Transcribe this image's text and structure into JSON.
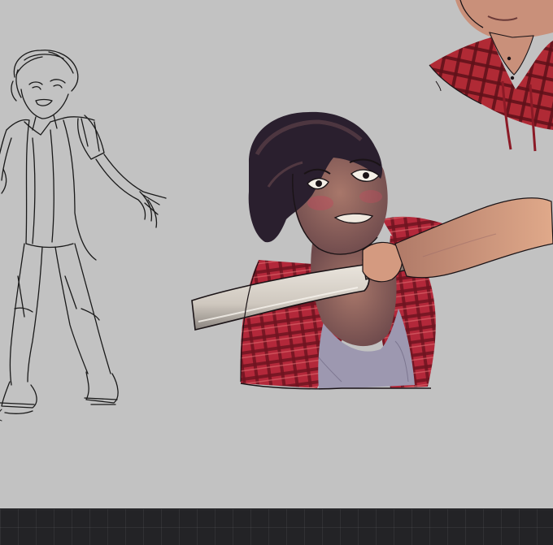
{
  "canvas": {
    "background_color": "#c2c2c2",
    "sketches": [
      {
        "name": "standing-figure-pencil-sketch",
        "style": "line-art",
        "color": "#1a1a1a"
      },
      {
        "name": "character-with-machete-colored-sketch",
        "style": "colored",
        "colors": {
          "hair": "#2a1f2e",
          "skin": "#9b6a5a",
          "shirt": "#b3283a",
          "tanktop": "#9d98b0",
          "blade": "#d8d3cc"
        }
      },
      {
        "name": "partial-torso-colored-sketch",
        "style": "colored",
        "colors": {
          "skin": "#c9907a",
          "shirt": "#b02a35"
        }
      }
    ]
  },
  "bottom_bar": {
    "background_color": "#232326",
    "pattern": "grid"
  }
}
